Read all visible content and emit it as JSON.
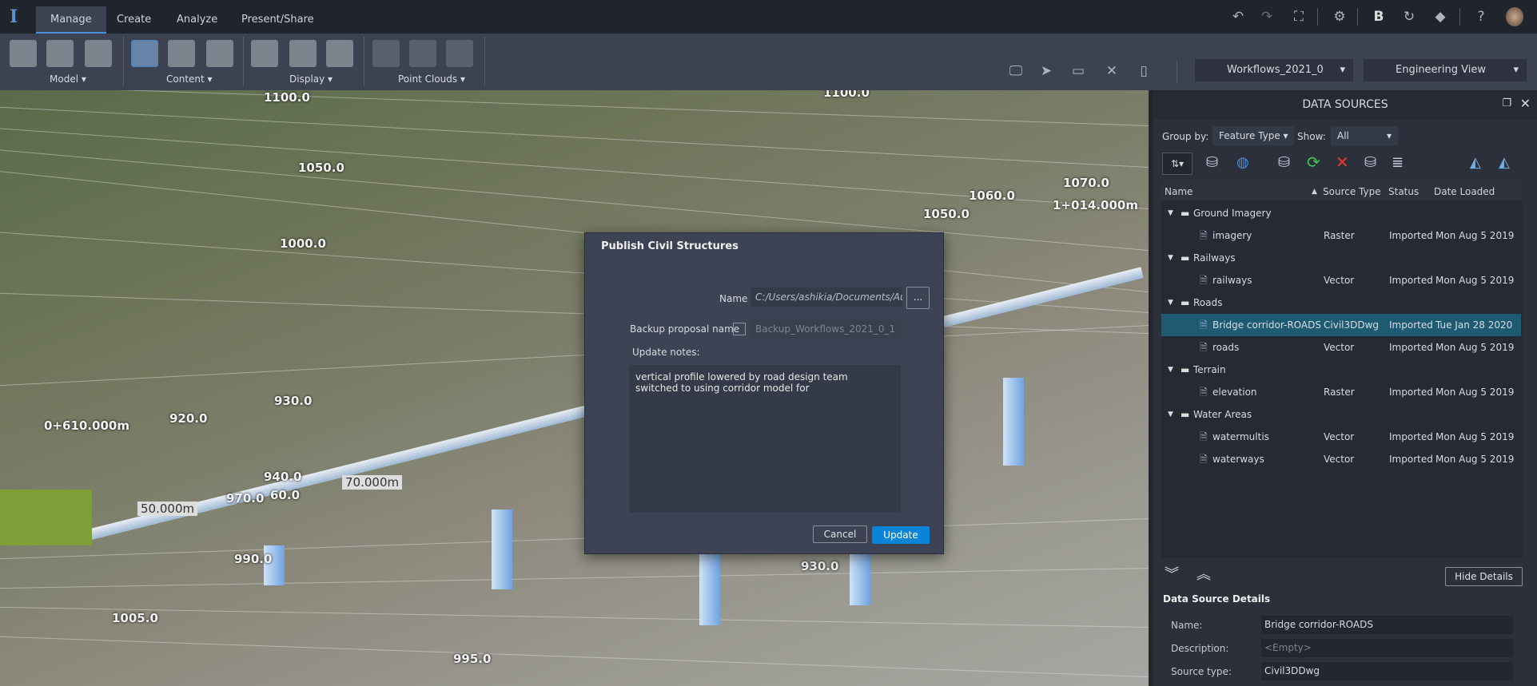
{
  "app": {
    "tabs": [
      "Manage",
      "Create",
      "Analyze",
      "Present/Share"
    ],
    "active_tab": "Manage"
  },
  "top_icons": [
    "undo-icon",
    "redo-icon",
    "fullscreen-icon",
    "gear-icon",
    "bold-b-icon",
    "refresh-icon",
    "cube-icon",
    "help-icon",
    "avatar"
  ],
  "ribbon": {
    "groups": [
      "Model",
      "Content",
      "Display",
      "Point Clouds"
    ],
    "proposal": "Workflows_2021_0",
    "view": "Engineering View"
  },
  "viewport": {
    "labels": [
      "1100.0",
      "1050.0",
      "1000.0",
      "930.0",
      "920.0",
      "0+610.000m",
      "940.0",
      "970.0",
      "60.0",
      "50.000m",
      "70.000m",
      "990.0",
      "1005.0",
      "995.0",
      "930.0",
      "1060.0",
      "1050.0",
      "1070.0",
      "1+014.000m",
      "1100.0"
    ]
  },
  "dialog": {
    "title": "Publish Civil Structures",
    "name_label": "Name",
    "name_value": "C:/Users/ashikia/Documents/Aut",
    "browse": "...",
    "backup_label": "Backup proposal name",
    "backup_checked": false,
    "backup_value": "Backup_Workflows_2021_0_1",
    "notes_label": "Update notes:",
    "notes_lines": [
      "vertical profile lowered by road design team",
      "switched to using corridor model for"
    ],
    "cancel": "Cancel",
    "update": "Update",
    "accent": "#0a84d6"
  },
  "panel": {
    "title": "DATA SOURCES",
    "group_by_label": "Group by:",
    "group_by": "Feature Type",
    "show_label": "Show:",
    "show": "All",
    "columns": [
      "Name",
      "Source Type",
      "Status",
      "Date Loaded"
    ],
    "rows": [
      {
        "type": "group",
        "name": "Ground Imagery"
      },
      {
        "type": "item",
        "name": "imagery",
        "source": "Raster",
        "status": "Imported",
        "date": "Mon Aug 5 2019"
      },
      {
        "type": "group",
        "name": "Railways"
      },
      {
        "type": "item",
        "name": "railways",
        "source": "Vector",
        "status": "Imported",
        "date": "Mon Aug 5 2019"
      },
      {
        "type": "group",
        "name": "Roads"
      },
      {
        "type": "item",
        "name": "Bridge corridor-ROADS",
        "source": "Civil3DDwg",
        "status": "Imported",
        "date": "Tue Jan 28 2020",
        "selected": true
      },
      {
        "type": "item",
        "name": "roads",
        "source": "Vector",
        "status": "Imported",
        "date": "Mon Aug 5 2019"
      },
      {
        "type": "group",
        "name": "Terrain"
      },
      {
        "type": "item",
        "name": "elevation",
        "source": "Raster",
        "status": "Imported",
        "date": "Mon Aug 5 2019"
      },
      {
        "type": "group",
        "name": "Water Areas"
      },
      {
        "type": "item",
        "name": "watermultis",
        "source": "Vector",
        "status": "Imported",
        "date": "Mon Aug 5 2019"
      },
      {
        "type": "item",
        "name": "waterways",
        "source": "Vector",
        "status": "Imported",
        "date": "Mon Aug 5 2019"
      }
    ],
    "hide_details": "Hide Details",
    "details_title": "Data Source Details",
    "details": [
      {
        "label": "Name:",
        "value": "Bridge corridor-ROADS"
      },
      {
        "label": "Description:",
        "value": "<Empty>"
      },
      {
        "label": "Source type:",
        "value": "Civil3DDwg"
      }
    ]
  }
}
